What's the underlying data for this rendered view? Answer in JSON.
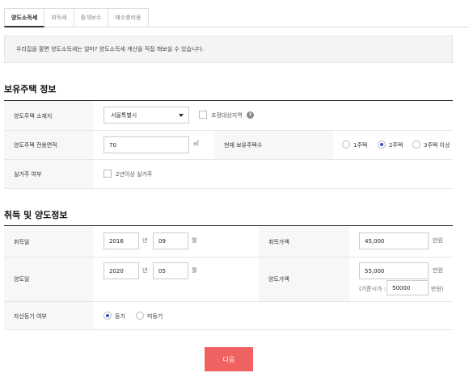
{
  "tabs": [
    {
      "label": "양도소득세"
    },
    {
      "label": "취득세"
    },
    {
      "label": "중개보수"
    },
    {
      "label": "매수총비용"
    }
  ],
  "notice": "우리집을 팔면 양도소득세는 얼마? 양도소득세 계산을 직접 해보실 수 있습니다.",
  "housing": {
    "title": "보유주택 정보",
    "location_label": "양도주택 소재지",
    "location_value": "서울특별시",
    "adjusted_area_label": "조정대상지역",
    "area_label": "양도주택 전용면적",
    "area_value": "70",
    "area_unit": "㎡",
    "count_label": "현재 보유주택수",
    "count_options": [
      "1주택",
      "2주택",
      "3주택 이상"
    ],
    "count_selected": "2주택",
    "residence_label": "실거주 여부",
    "residence_option": "2년이상 실거주"
  },
  "transfer": {
    "title": "취득 및 양도정보",
    "acq_date_label": "취득일",
    "acq_year": "2016",
    "acq_month": "09",
    "year_unit": "년",
    "month_unit": "월",
    "acq_price_label": "취득가액",
    "acq_price": "45,000",
    "price_unit": "만원",
    "sale_date_label": "양도일",
    "sale_year": "2020",
    "sale_month": "05",
    "sale_price_label": "양도가액",
    "sale_price": "55,000",
    "std_price_label": "(기준시가 :",
    "std_price": "50000",
    "std_unit": "만원)",
    "registered_label": "자산등기 여부",
    "registered_options": [
      "등기",
      "미등기"
    ],
    "registered_selected": "등기"
  },
  "next_button": "다음"
}
